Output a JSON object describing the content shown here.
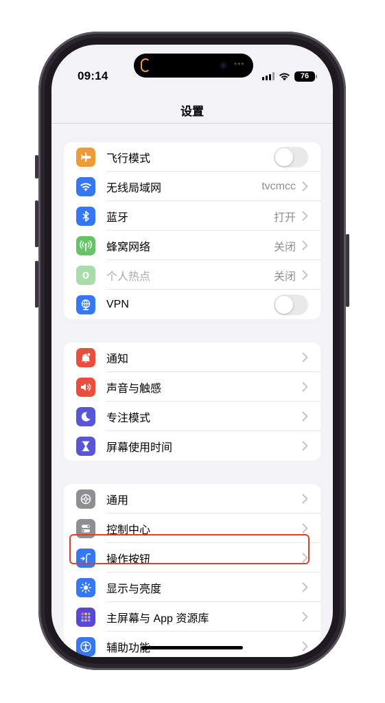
{
  "status_bar": {
    "time": "09:14",
    "battery": "76"
  },
  "nav": {
    "title": "设置"
  },
  "groups": [
    {
      "rows": [
        {
          "label": "飞行模式",
          "icon": "airplane-icon",
          "color": "#f09a37",
          "accessory": "toggle",
          "on": false
        },
        {
          "label": "无线局域网",
          "icon": "wifi-icon",
          "color": "#3478f6",
          "value": "tvcmcc"
        },
        {
          "label": "蓝牙",
          "icon": "bluetooth-icon",
          "color": "#3478f6",
          "value": "打开"
        },
        {
          "label": "蜂窝网络",
          "icon": "cellular-icon",
          "color": "#65c466",
          "value": "关闭"
        },
        {
          "label": "个人热点",
          "icon": "hotspot-icon",
          "color": "#a8dcaa",
          "value": "关闭",
          "dim": true
        },
        {
          "label": "VPN",
          "icon": "vpn-icon",
          "color": "#3478f6",
          "accessory": "toggle",
          "on": false
        }
      ]
    },
    {
      "rows": [
        {
          "label": "通知",
          "icon": "notification-icon",
          "color": "#eb4e3d"
        },
        {
          "label": "声音与触感",
          "icon": "speaker-icon",
          "color": "#eb4e3d"
        },
        {
          "label": "专注模式",
          "icon": "moon-icon",
          "color": "#5856d6"
        },
        {
          "label": "屏幕使用时间",
          "icon": "hourglass-icon",
          "color": "#5856d6"
        }
      ]
    },
    {
      "rows": [
        {
          "label": "通用",
          "icon": "gear-icon",
          "color": "#8e8e93"
        },
        {
          "label": "控制中心",
          "icon": "control-center-icon",
          "color": "#8e8e93"
        },
        {
          "label": "操作按钮",
          "icon": "action-button-icon",
          "color": "#3478f6"
        },
        {
          "label": "显示与亮度",
          "icon": "brightness-icon",
          "color": "#3478f6"
        },
        {
          "label": "主屏幕与 App 资源库",
          "icon": "home-screen-icon",
          "color": "#5b47d4"
        },
        {
          "label": "辅助功能",
          "icon": "accessibility-icon",
          "color": "#3478f6"
        }
      ]
    }
  ],
  "highlight_color": "#d9412f"
}
